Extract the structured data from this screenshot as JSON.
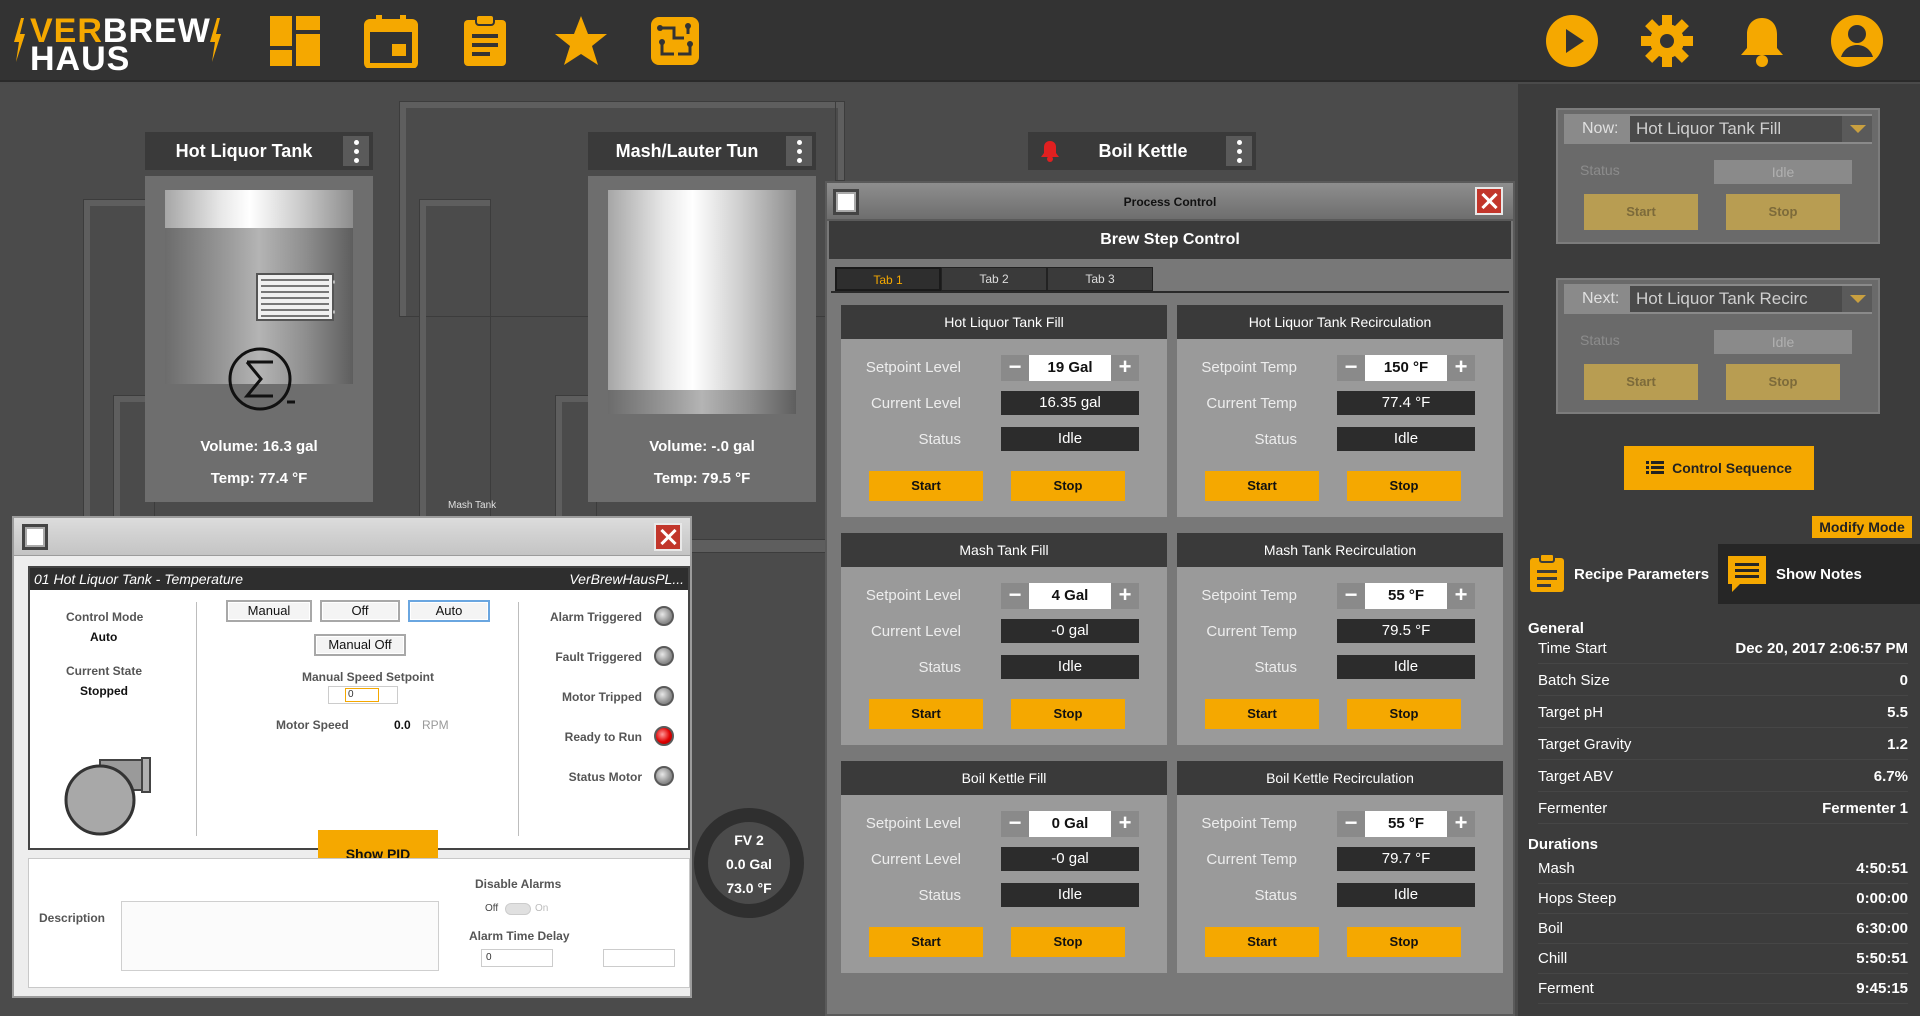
{
  "app": {
    "logo_top": "VERBREW",
    "logo_bottom": "HAUS"
  },
  "nav": {
    "icons": [
      "dashboard-icon",
      "calendar-icon",
      "clipboard-icon",
      "star-icon",
      "circuit-icon"
    ],
    "right_icons": [
      "play-icon",
      "gear-icon",
      "bell-icon",
      "user-icon"
    ]
  },
  "colors": {
    "accent": "#f5a800",
    "background": "#4b4b4b",
    "dark": "#333333"
  },
  "tanks": [
    {
      "title": "Hot Liquor Tank",
      "volume": "Volume: 16.3 gal",
      "temp": "Temp: 77.4 °F"
    },
    {
      "title": "Mash/Lauter Tun",
      "volume": "Volume: -.0 gal",
      "temp": "Temp: 79.5 °F"
    },
    {
      "title": "Boil Kettle"
    }
  ],
  "pipe_labels": {
    "mash_tank": "Mash Tank"
  },
  "fv2": {
    "name": "FV 2",
    "volume": "0.0 Gal",
    "temp": "73.0 °F"
  },
  "process_control": {
    "window_title": "Process Control",
    "heading": "Brew Step Control",
    "tabs": [
      "Tab 1",
      "Tab 2",
      "Tab 3"
    ],
    "cards": [
      {
        "title": "Hot Liquor Tank Fill",
        "setpoint_label": "Setpoint Level",
        "setpoint": "19 Gal",
        "current_label": "Current Level",
        "current": "16.35  gal",
        "status_label": "Status",
        "status": "Idle",
        "start": "Start",
        "stop": "Stop"
      },
      {
        "title": "Hot Liquor Tank Recirculation",
        "setpoint_label": "Setpoint Temp",
        "setpoint": "150 °F",
        "current_label": "Current Temp",
        "current": "77.4  °F",
        "status_label": "Status",
        "status": "Idle",
        "start": "Start",
        "stop": "Stop"
      },
      {
        "title": "Mash Tank Fill",
        "setpoint_label": "Setpoint Level",
        "setpoint": "4 Gal",
        "current_label": "Current Level",
        "current": "-0  gal",
        "status_label": "Status",
        "status": "Idle",
        "start": "Start",
        "stop": "Stop"
      },
      {
        "title": "Mash Tank Recirculation",
        "setpoint_label": "Setpoint Temp",
        "setpoint": "55 °F",
        "current_label": "Current Temp",
        "current": "79.5  °F",
        "status_label": "Status",
        "status": "Idle",
        "start": "Start",
        "stop": "Stop"
      },
      {
        "title": "Boil Kettle Fill",
        "setpoint_label": "Setpoint Level",
        "setpoint": "0 Gal",
        "current_label": "Current Level",
        "current": "-0  gal",
        "status_label": "Status",
        "status": "Idle",
        "start": "Start",
        "stop": "Stop"
      },
      {
        "title": "Boil Kettle Recirculation",
        "setpoint_label": "Setpoint Temp",
        "setpoint": "55 °F",
        "current_label": "Current Temp",
        "current": "79.7  °F",
        "status_label": "Status",
        "status": "Idle",
        "start": "Start",
        "stop": "Stop"
      }
    ]
  },
  "faceplate": {
    "header_left": "01 Hot Liquor Tank - Temperature",
    "header_right": "VerBrewHausPL...",
    "control_mode_label": "Control Mode",
    "control_mode": "Auto",
    "current_state_label": "Current State",
    "current_state": "Stopped",
    "mode_buttons": [
      "Manual",
      "Off",
      "Auto"
    ],
    "manual_off": "Manual Off",
    "manual_speed_label": "Manual Speed Setpoint",
    "manual_speed_value": "0",
    "motor_speed_label": "Motor Speed",
    "motor_speed_value": "0.0",
    "motor_speed_unit": "RPM",
    "show_pid": "Show PID",
    "lamps": [
      "Alarm Triggered",
      "Fault Triggered",
      "Motor Tripped",
      "Ready to Run",
      "Status Motor"
    ],
    "description_label": "Description",
    "disable_alarms_label": "Disable Alarms",
    "toggle_off": "Off",
    "toggle_on": "On",
    "alarm_delay_label": "Alarm Time Delay",
    "alarm_delay_value": "0"
  },
  "right_panel": {
    "now_label": "Now:",
    "now_value": "Hot Liquor Tank Fill",
    "next_label": "Next:",
    "next_value": "Hot Liquor Tank Recirc",
    "status_label": "Status",
    "status_value": "Idle",
    "start": "Start",
    "stop": "Stop",
    "control_sequence": "Control Sequence",
    "modify_mode": "Modify Mode",
    "recipe_tab": "Recipe Parameters",
    "notes_tab": "Show Notes",
    "general_title": "General",
    "general": [
      {
        "k": "Time Start",
        "v": "Dec 20, 2017 2:06:57 PM"
      },
      {
        "k": "Batch Size",
        "v": "0"
      },
      {
        "k": "Target pH",
        "v": "5.5"
      },
      {
        "k": "Target Gravity",
        "v": "1.2"
      },
      {
        "k": "Target ABV",
        "v": "6.7%"
      },
      {
        "k": "Fermenter",
        "v": "Fermenter 1"
      }
    ],
    "durations_title": "Durations",
    "durations": [
      {
        "k": "Mash",
        "v": "4:50:51"
      },
      {
        "k": "Hops Steep",
        "v": "0:00:00"
      },
      {
        "k": "Boil",
        "v": "6:30:00"
      },
      {
        "k": "Chill",
        "v": "5:50:51"
      },
      {
        "k": "Ferment",
        "v": "9:45:15"
      }
    ]
  }
}
